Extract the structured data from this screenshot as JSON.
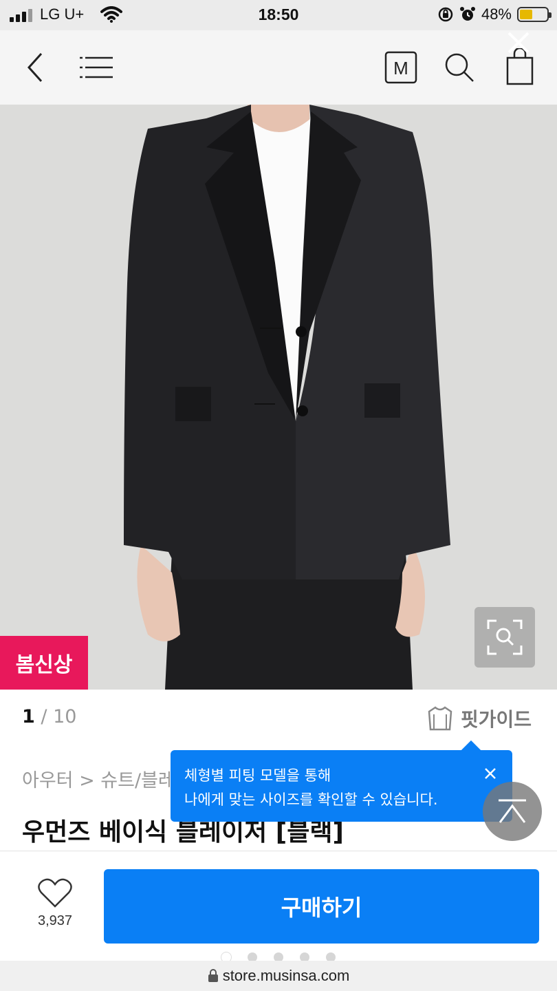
{
  "status_bar": {
    "carrier": "LG U+",
    "time": "18:50",
    "battery_percent": "48%",
    "battery_level": 0.48,
    "icons": [
      "signal-icon",
      "wifi-icon",
      "orientation-lock-icon",
      "alarm-icon",
      "battery-icon"
    ]
  },
  "nav": {
    "icons": [
      "back-icon",
      "menu-icon",
      "musinsa-m-icon",
      "search-icon",
      "shopping-bag-icon",
      "close-icon"
    ],
    "m_label": "M"
  },
  "product": {
    "badge": "봄신상",
    "image_index": "1",
    "image_separator": "/",
    "image_total": "10",
    "fit_guide_label": "핏가이드",
    "breadcrumb": "아우터 > 슈트/블레",
    "title": "우먼즈 베이식 블레이저 [블랙]"
  },
  "tooltip": {
    "line1": "체형별 피팅 모델을 통해",
    "line2": "나에게 맞는 사이즈를 확인할 수 있습니다."
  },
  "bottom_bar": {
    "like_count": "3,937",
    "buy_label": "구매하기"
  },
  "browser": {
    "url": "store.musinsa.com",
    "page_dots": 5,
    "active_dot": 1
  },
  "colors": {
    "accent_blue": "#0a7ff5",
    "badge_pink": "#e8185b"
  }
}
